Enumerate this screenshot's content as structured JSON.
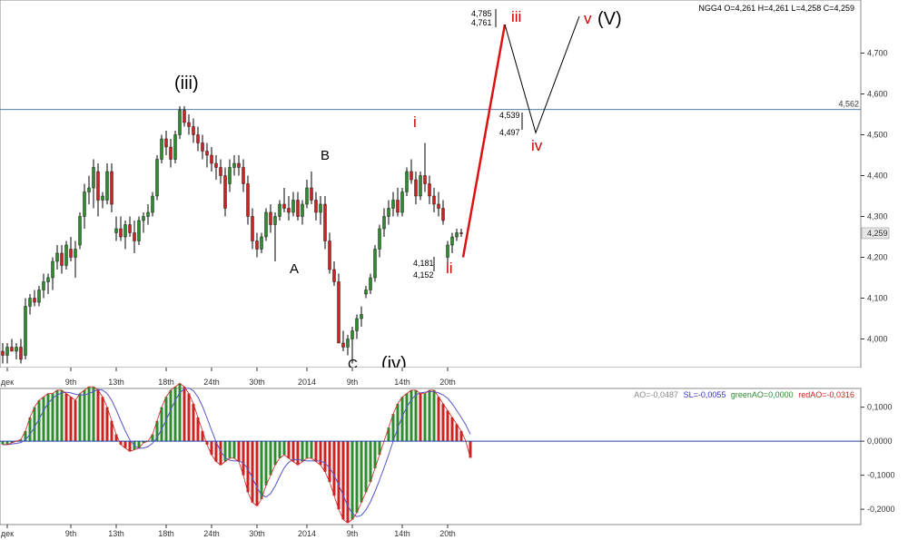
{
  "chart_data": [
    {
      "type": "candlestick",
      "instrument": {
        "symbol": "NGG4",
        "open": "4,261",
        "high": "4,261",
        "low": "4,258",
        "close": "4,259",
        "info_text": "NGG4 O=4,261 H=4,261 L=4,258 C=4,259"
      },
      "y_range": [
        3.93,
        4.83
      ],
      "y_ticks": [
        {
          "value": 4.0,
          "label": "4,000"
        },
        {
          "value": 4.1,
          "label": "4,100"
        },
        {
          "value": 4.2,
          "label": "4,200"
        },
        {
          "value": 4.3,
          "label": "4,300"
        },
        {
          "value": 4.4,
          "label": "4,400"
        },
        {
          "value": 4.5,
          "label": "4,500"
        },
        {
          "value": 4.6,
          "label": "4,600"
        },
        {
          "value": 4.7,
          "label": "4,700"
        }
      ],
      "last_price": {
        "value": 4.259,
        "label": "4,259"
      },
      "x_labels": [
        "дек",
        "9th",
        "13th",
        "18th",
        "24th",
        "30th",
        "2014",
        "9th",
        "14th",
        "20th"
      ],
      "x_label_bars": [
        1,
        15,
        25,
        36,
        46,
        56,
        67,
        77,
        88,
        98
      ],
      "horizontal_line": {
        "value": 4.562,
        "label": "4,562",
        "color": "#4f7f9f"
      },
      "candle_colors": {
        "up": "#2e8b2e",
        "down": "#cc2222",
        "wick": "#000000"
      },
      "candles": [
        [
          3.97,
          3.99,
          3.94,
          3.96
        ],
        [
          3.96,
          3.99,
          3.94,
          3.98
        ],
        [
          3.98,
          4.0,
          3.97,
          3.97
        ],
        [
          3.97,
          3.99,
          3.95,
          3.98
        ],
        [
          3.98,
          4.0,
          3.94,
          3.95
        ],
        [
          3.96,
          4.1,
          3.95,
          4.08
        ],
        [
          4.08,
          4.11,
          4.06,
          4.1
        ],
        [
          4.1,
          4.12,
          4.08,
          4.09
        ],
        [
          4.09,
          4.13,
          4.08,
          4.12
        ],
        [
          4.12,
          4.16,
          4.1,
          4.14
        ],
        [
          4.14,
          4.16,
          4.11,
          4.15
        ],
        [
          4.15,
          4.2,
          4.12,
          4.19
        ],
        [
          4.19,
          4.23,
          4.17,
          4.21
        ],
        [
          4.21,
          4.23,
          4.16,
          4.18
        ],
        [
          4.18,
          4.24,
          4.17,
          4.23
        ],
        [
          4.22,
          4.25,
          4.19,
          4.2
        ],
        [
          4.2,
          4.24,
          4.15,
          4.22
        ],
        [
          4.23,
          4.31,
          4.22,
          4.3
        ],
        [
          4.3,
          4.38,
          4.27,
          4.36
        ],
        [
          4.36,
          4.4,
          4.33,
          4.37
        ],
        [
          4.37,
          4.44,
          4.32,
          4.42
        ],
        [
          4.41,
          4.43,
          4.3,
          4.34
        ],
        [
          4.34,
          4.36,
          4.32,
          4.35
        ],
        [
          4.34,
          4.43,
          4.33,
          4.41
        ],
        [
          4.41,
          4.43,
          4.31,
          4.33
        ],
        [
          4.26,
          4.3,
          4.24,
          4.27
        ],
        [
          4.27,
          4.3,
          4.24,
          4.25
        ],
        [
          4.25,
          4.29,
          4.22,
          4.28
        ],
        [
          4.28,
          4.3,
          4.25,
          4.26
        ],
        [
          4.26,
          4.29,
          4.21,
          4.24
        ],
        [
          4.24,
          4.3,
          4.23,
          4.29
        ],
        [
          4.29,
          4.31,
          4.26,
          4.3
        ],
        [
          4.3,
          4.33,
          4.28,
          4.31
        ],
        [
          4.31,
          4.36,
          4.3,
          4.35
        ],
        [
          4.35,
          4.45,
          4.34,
          4.44
        ],
        [
          4.44,
          4.5,
          4.43,
          4.49
        ],
        [
          4.49,
          4.51,
          4.45,
          4.47
        ],
        [
          4.47,
          4.49,
          4.42,
          4.44
        ],
        [
          4.44,
          4.51,
          4.43,
          4.5
        ],
        [
          4.5,
          4.57,
          4.49,
          4.56
        ],
        [
          4.56,
          4.57,
          4.52,
          4.53
        ],
        [
          4.53,
          4.55,
          4.5,
          4.52
        ],
        [
          4.52,
          4.54,
          4.48,
          4.5
        ],
        [
          4.5,
          4.52,
          4.46,
          4.48
        ],
        [
          4.48,
          4.5,
          4.44,
          4.46
        ],
        [
          4.46,
          4.48,
          4.42,
          4.45
        ],
        [
          4.45,
          4.47,
          4.41,
          4.43
        ],
        [
          4.43,
          4.45,
          4.39,
          4.42
        ],
        [
          4.42,
          4.44,
          4.38,
          4.4
        ],
        [
          4.4,
          4.42,
          4.3,
          4.32
        ],
        [
          4.38,
          4.44,
          4.36,
          4.42
        ],
        [
          4.42,
          4.45,
          4.4,
          4.43
        ],
        [
          4.43,
          4.45,
          4.4,
          4.42
        ],
        [
          4.42,
          4.44,
          4.36,
          4.38
        ],
        [
          4.38,
          4.4,
          4.28,
          4.3
        ],
        [
          4.3,
          4.32,
          4.22,
          4.24
        ],
        [
          4.24,
          4.26,
          4.2,
          4.22
        ],
        [
          4.22,
          4.26,
          4.21,
          4.25
        ],
        [
          4.25,
          4.32,
          4.24,
          4.31
        ],
        [
          4.31,
          4.33,
          4.26,
          4.28
        ],
        [
          4.28,
          4.31,
          4.19,
          4.3
        ],
        [
          4.3,
          4.34,
          4.29,
          4.33
        ],
        [
          4.33,
          4.37,
          4.31,
          4.32
        ],
        [
          4.32,
          4.35,
          4.29,
          4.31
        ],
        [
          4.31,
          4.36,
          4.3,
          4.34
        ],
        [
          4.34,
          4.36,
          4.29,
          4.3
        ],
        [
          4.3,
          4.34,
          4.28,
          4.33
        ],
        [
          4.33,
          4.39,
          4.32,
          4.37
        ],
        [
          4.37,
          4.41,
          4.33,
          4.34
        ],
        [
          4.34,
          4.36,
          4.29,
          4.31
        ],
        [
          4.31,
          4.35,
          4.28,
          4.33
        ],
        [
          4.33,
          4.35,
          4.22,
          4.24
        ],
        [
          4.24,
          4.26,
          4.16,
          4.17
        ],
        [
          4.17,
          4.19,
          4.13,
          4.14
        ],
        [
          4.14,
          4.16,
          4.0,
          3.99
        ],
        [
          3.99,
          4.02,
          3.97,
          3.98
        ],
        [
          3.98,
          4.01,
          3.96,
          4.0
        ],
        [
          4.0,
          4.03,
          3.94,
          4.02
        ],
        [
          4.02,
          4.06,
          4.0,
          4.05
        ],
        [
          4.05,
          4.08,
          4.03,
          4.06
        ],
        [
          4.11,
          4.13,
          4.1,
          4.12
        ],
        [
          4.12,
          4.16,
          4.11,
          4.15
        ],
        [
          4.15,
          4.23,
          4.14,
          4.22
        ],
        [
          4.22,
          4.28,
          4.2,
          4.27
        ],
        [
          4.27,
          4.32,
          4.25,
          4.3
        ],
        [
          4.3,
          4.34,
          4.28,
          4.32
        ],
        [
          4.32,
          4.36,
          4.3,
          4.34
        ],
        [
          4.34,
          4.37,
          4.3,
          4.31
        ],
        [
          4.31,
          4.37,
          4.3,
          4.36
        ],
        [
          4.36,
          4.42,
          4.35,
          4.41
        ],
        [
          4.41,
          4.44,
          4.38,
          4.39
        ],
        [
          4.39,
          4.41,
          4.33,
          4.35
        ],
        [
          4.35,
          4.41,
          4.34,
          4.4
        ],
        [
          4.4,
          4.48,
          4.36,
          4.38
        ],
        [
          4.38,
          4.4,
          4.33,
          4.35
        ],
        [
          4.35,
          4.37,
          4.31,
          4.33
        ],
        [
          4.33,
          4.36,
          4.3,
          4.32
        ],
        [
          4.32,
          4.34,
          4.28,
          4.29
        ],
        [
          4.2,
          4.24,
          4.18,
          4.23
        ],
        [
          4.23,
          4.26,
          4.21,
          4.25
        ],
        [
          4.25,
          4.27,
          4.24,
          4.26
        ],
        [
          4.26,
          4.27,
          4.25,
          4.259
        ]
      ],
      "projection": {
        "red_line": [
          [
            4.2,
            4.77
          ]
        ],
        "black_path": [
          4.77,
          4.505,
          4.79
        ]
      },
      "annotations": {
        "wave_labels": [
          {
            "text": "(iii)",
            "color": "#000000"
          },
          {
            "text": "A",
            "color": "#000000"
          },
          {
            "text": "B",
            "color": "#000000"
          },
          {
            "text": "C",
            "color": "#000000"
          },
          {
            "text": "(iv)",
            "color": "#000000"
          },
          {
            "text": "i",
            "color": "#cc0000"
          },
          {
            "text": "ii",
            "color": "#cc0000"
          },
          {
            "text": "iii",
            "color": "#cc0000"
          },
          {
            "text": "iv",
            "color": "#cc0000"
          },
          {
            "text": "v",
            "color": "#cc0000"
          },
          {
            "text": "(V)",
            "color": "#000000"
          }
        ],
        "price_labels": [
          "4,785",
          "4,761",
          "4,539",
          "4,497",
          "4,181",
          "4,152"
        ]
      }
    },
    {
      "type": "bar",
      "indicator": "Awesome Oscillator",
      "info": {
        "ao": {
          "text": "AO=-0,0487",
          "color": "#888888"
        },
        "sl": {
          "text": "SL=-0,0055",
          "color": "#3333cc"
        },
        "green_ao": {
          "text": "greenAO=0,0000",
          "color": "#2e8b2e"
        },
        "red_ao": {
          "text": "redAO=-0,0316",
          "color": "#cc2222"
        }
      },
      "y_range": [
        -0.245,
        0.155
      ],
      "y_ticks": [
        {
          "value": 0.1,
          "label": "0,1000"
        },
        {
          "value": 0.0,
          "label": "0,0000"
        },
        {
          "value": -0.1,
          "label": "-0,1000"
        },
        {
          "value": -0.2,
          "label": "-0,2000"
        }
      ],
      "x_labels": [
        "дек",
        "9th",
        "13th",
        "18th",
        "24th",
        "30th",
        "2014",
        "9th",
        "14th",
        "20th"
      ],
      "colors": {
        "up": "#2e8b2e",
        "down": "#cc2222",
        "zero_line": "#2244aa",
        "signal": "#5555cc",
        "envelope": "#cc2222"
      },
      "ao_values": [
        -0.01,
        -0.01,
        -0.005,
        0.0,
        0.005,
        0.03,
        0.07,
        0.1,
        0.12,
        0.13,
        0.14,
        0.14,
        0.15,
        0.15,
        0.14,
        0.13,
        0.12,
        0.14,
        0.15,
        0.16,
        0.16,
        0.15,
        0.13,
        0.1,
        0.06,
        0.02,
        -0.01,
        -0.02,
        -0.03,
        -0.025,
        -0.02,
        -0.005,
        0.0,
        0.02,
        0.06,
        0.1,
        0.13,
        0.15,
        0.16,
        0.17,
        0.16,
        0.14,
        0.11,
        0.07,
        0.03,
        -0.01,
        -0.04,
        -0.06,
        -0.07,
        -0.06,
        -0.05,
        -0.05,
        -0.06,
        -0.1,
        -0.15,
        -0.18,
        -0.19,
        -0.17,
        -0.13,
        -0.1,
        -0.07,
        -0.05,
        -0.04,
        -0.05,
        -0.06,
        -0.07,
        -0.06,
        -0.05,
        -0.05,
        -0.06,
        -0.07,
        -0.09,
        -0.12,
        -0.16,
        -0.2,
        -0.23,
        -0.24,
        -0.23,
        -0.21,
        -0.18,
        -0.15,
        -0.12,
        -0.08,
        -0.04,
        0.0,
        0.04,
        0.08,
        0.11,
        0.13,
        0.14,
        0.15,
        0.15,
        0.14,
        0.14,
        0.15,
        0.15,
        0.13,
        0.11,
        0.09,
        0.07,
        0.05,
        0.03,
        0.0,
        -0.0487
      ]
    }
  ]
}
